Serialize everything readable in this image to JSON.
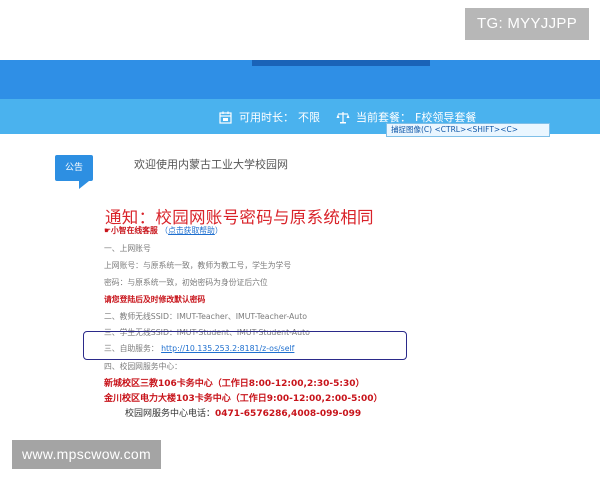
{
  "watermark_top": "TG: MYYJJPP",
  "watermark_bottom": "www.mpscwow.com",
  "status_bar": {
    "duration_label": "可用时长：",
    "duration_value": "不限",
    "package_label": "当前套餐：",
    "package_value": "F校领导套餐",
    "duration_icon": "calendar-icon",
    "package_icon": "scale-icon"
  },
  "capture_tip": "捕捉图像(C)  <CTRL><SHIFT><C>",
  "notice": {
    "badge": "公告",
    "welcome": "欢迎使用内蒙古工业大学校园网",
    "headline": "通知：校园网账号密码与原系统相同",
    "help_prefix": "☛小智在线客服",
    "help_link": "点击获取帮助",
    "lines": [
      "一、上网账号",
      "上网账号：与原系统一致，教师为教工号，学生为学号",
      "密码：与原系统一致，初始密码为身份证后六位",
      "请您登陆后及时修改默认密码",
      "二、教师无线SSID：IMUT-Teacher、IMUT-Teacher-Auto",
      "三、学生无线SSID：IMUT-Student、IMUT-Student-Auto",
      "三、自助服务：",
      "四、校园网服务中心："
    ],
    "self_service_url": "http://10.135.253.2:8181/z-os/self",
    "service_centers": [
      "新城校区三教106卡务中心（工作日8:00-12:00,2:30-5:30）",
      "金川校区电力大楼103卡务中心（工作日9:00-12:00,2:00-5:00）"
    ],
    "tel_label": "校园网服务中心电话：",
    "tel_value": "0471-6576286,4008-099-099"
  },
  "colors": {
    "band_dark": "#2f8fe6",
    "band_light": "#4ab2ee",
    "headline_red": "#d9232a",
    "link_blue": "#1e6fcf",
    "highlight_box": "#2b2a8a"
  }
}
